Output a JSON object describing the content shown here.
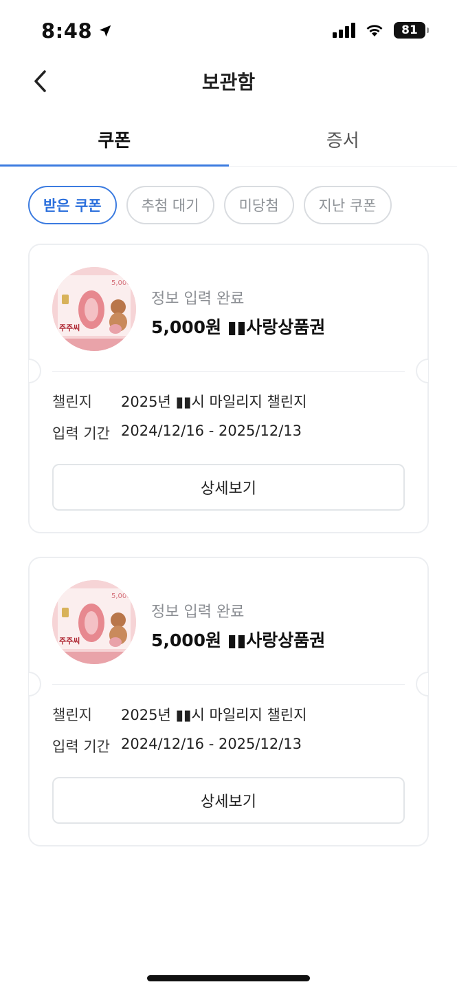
{
  "status_bar": {
    "time": "8:48",
    "battery": "81"
  },
  "header": {
    "title": "보관함"
  },
  "tabs": [
    {
      "label": "쿠폰",
      "active": true
    },
    {
      "label": "증서",
      "active": false
    }
  ],
  "filters": [
    {
      "label": "받은 쿠폰",
      "active": true
    },
    {
      "label": "추첨 대기",
      "active": false
    },
    {
      "label": "미당첨",
      "active": false
    },
    {
      "label": "지난 쿠폰",
      "active": false
    }
  ],
  "coupons": [
    {
      "status": "정보 입력 완료",
      "title": "5,000원 ▮▮사랑상품권",
      "challenge_label": "챌린지",
      "challenge_value": "2025년 ▮▮시 마일리지 챌린지",
      "period_label": "입력 기간",
      "period_value": "2024/12/16 - 2025/12/13",
      "button_label": "상세보기",
      "thumb_text_top": "5,000",
      "thumb_text_bottom": "주주씨"
    },
    {
      "status": "정보 입력 완료",
      "title": "5,000원 ▮▮사랑상품권",
      "challenge_label": "챌린지",
      "challenge_value": "2025년 ▮▮시 마일리지 챌린지",
      "period_label": "입력 기간",
      "period_value": "2024/12/16 - 2025/12/13",
      "button_label": "상세보기",
      "thumb_text_top": "5,000",
      "thumb_text_bottom": "주주씨"
    }
  ],
  "colors": {
    "accent": "#3b7be0",
    "border": "#eceef1",
    "muted": "#8c8f94"
  }
}
